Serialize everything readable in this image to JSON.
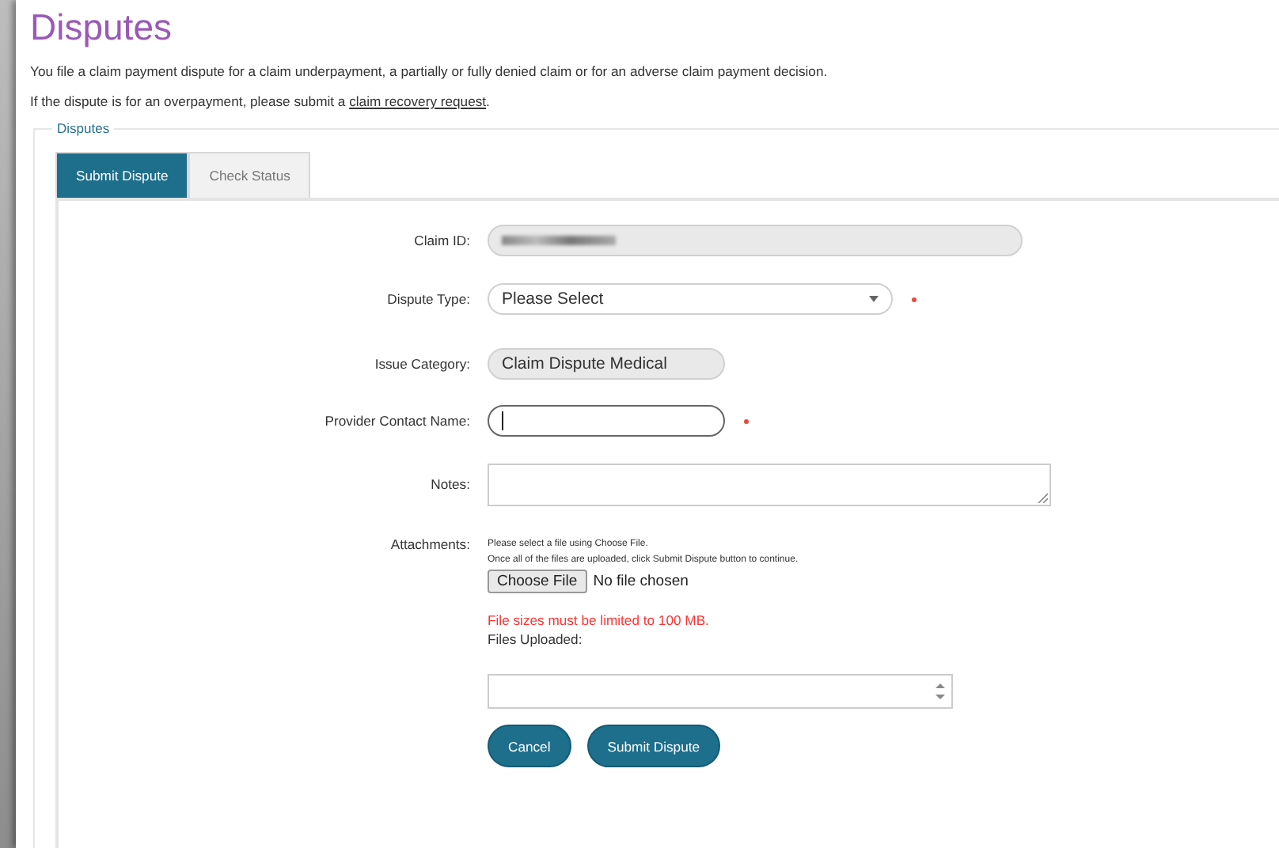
{
  "title": "Disputes",
  "intro": "You file a claim payment dispute for a claim underpayment, a partially or fully denied claim or for an adverse claim payment decision.",
  "overpayment": {
    "text": "If the dispute is for an overpayment, please submit a ",
    "link": "claim recovery request",
    "end": "."
  },
  "legend": "Disputes",
  "tabs": [
    {
      "label": "Submit Dispute",
      "selected": true
    },
    {
      "label": "Check Status",
      "selected": false
    }
  ],
  "fields": [
    {
      "kind": "readonly",
      "label": "Claim ID:",
      "redacted": true,
      "required": false
    },
    {
      "kind": "select",
      "label": "Dispute Type:",
      "value": "Please Select",
      "required": true
    },
    {
      "kind": "readonly",
      "label": "Issue Category:",
      "value": "Claim Dispute Medical",
      "required": false
    },
    {
      "kind": "text",
      "label": "Provider Contact Name:",
      "focused": true,
      "required": true
    },
    {
      "kind": "textarea",
      "label": "Notes:",
      "required": false
    }
  ],
  "attachments": {
    "label": "Attachments:",
    "hints": [
      "Please select a file using Choose File.",
      "Once all of the files are uploaded, click Submit Dispute button to continue."
    ],
    "choose_button": "Choose File",
    "file_status": "No file chosen",
    "limit": "File sizes must be limited to 100 MB.",
    "uploaded_label": "Files Uploaded:"
  },
  "buttons": [
    "Cancel",
    "Submit Dispute"
  ]
}
